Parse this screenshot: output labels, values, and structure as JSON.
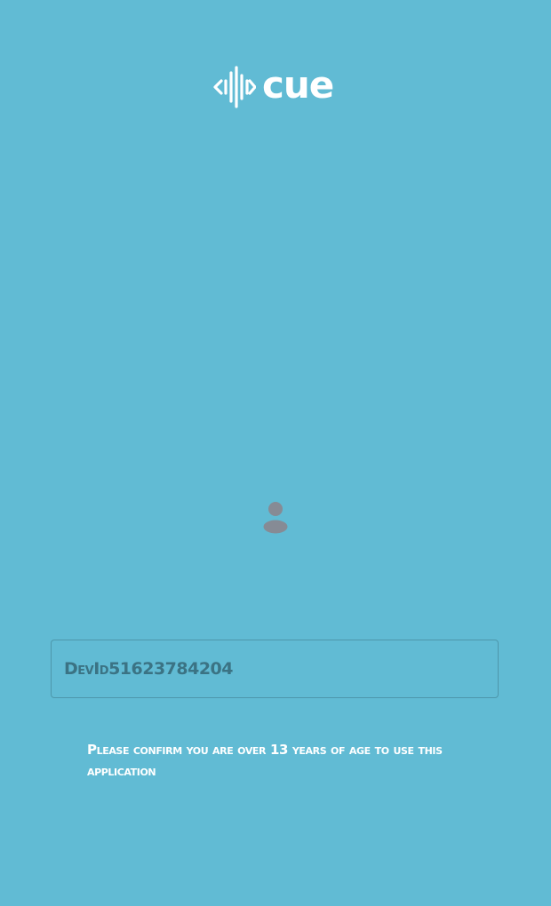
{
  "logo": {
    "text": "cue",
    "icon": "soundwave-brackets-icon"
  },
  "avatar": {
    "icon": "user-avatar-icon"
  },
  "username_field": {
    "value": "DevId51623784204"
  },
  "age_notice": {
    "text": "Please confirm you are over 13 years of age to use this application"
  },
  "colors": {
    "background": "#61bbd4",
    "logo": "#ffffff",
    "avatar": "#868b95",
    "field_border": "#4d97ab",
    "field_text": "#3b7384",
    "notice_text": "#ffffff"
  }
}
